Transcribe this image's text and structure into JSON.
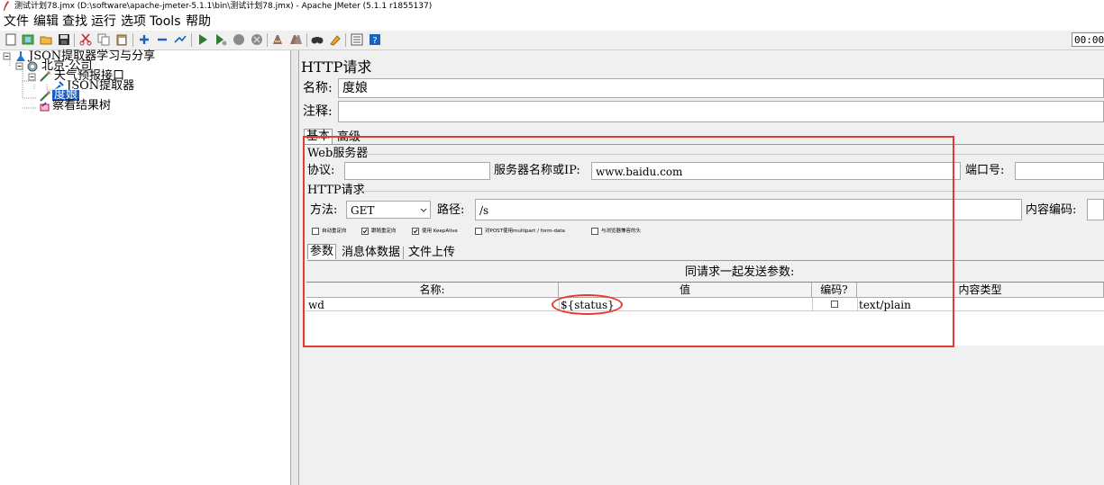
{
  "window": {
    "title": "测试计划78.jmx (D:\\software\\apache-jmeter-5.1.1\\bin\\测试计划78.jmx) - Apache JMeter (5.1.1 r1855137)"
  },
  "menu": {
    "items": [
      "文件",
      "编辑",
      "查找",
      "运行",
      "选项",
      "Tools",
      "帮助"
    ]
  },
  "toolbar": {
    "timer": "00:00",
    "icons": [
      "new-icon",
      "templates-icon",
      "open-icon",
      "save-icon",
      "cut-icon",
      "copy-icon",
      "paste-icon",
      "expand-icon",
      "collapse-icon",
      "toggle-icon",
      "start-icon",
      "start-no-pause-icon",
      "stop-icon",
      "shutdown-icon",
      "clear-icon",
      "clear-all-icon",
      "search-icon",
      "reset-search-icon",
      "function-helper-icon",
      "help-icon"
    ]
  },
  "tree": {
    "nodes": [
      {
        "label": "JSON提取器学习与分享",
        "icon": "test-plan-icon"
      },
      {
        "label": "北京-公司",
        "icon": "thread-group-icon"
      },
      {
        "label": "天气预报接口",
        "icon": "sampler-icon"
      },
      {
        "label": "JSON提取器",
        "icon": "extractor-icon"
      },
      {
        "label": "度娘",
        "icon": "sampler-icon",
        "selected": true
      },
      {
        "label": "察看结果树",
        "icon": "listener-icon"
      }
    ]
  },
  "panel": {
    "title": "HTTP请求",
    "name_label": "名称:",
    "name_value": "度娘",
    "comment_label": "注释:",
    "comment_value": "",
    "tabs": [
      "基本",
      "高级"
    ],
    "web_server": {
      "group_label": "Web服务器",
      "protocol_label": "协议:",
      "protocol_value": "",
      "server_label": "服务器名称或IP:",
      "server_value": "www.baidu.com",
      "port_label": "端口号:",
      "port_value": ""
    },
    "http_request": {
      "group_label": "HTTP请求",
      "method_label": "方法:",
      "method_value": "GET",
      "path_label": "路径:",
      "path_value": "/s",
      "encoding_label": "内容编码:",
      "encoding_value": ""
    },
    "options": [
      {
        "label": "自动重定向",
        "checked": false
      },
      {
        "label": "跟随重定向",
        "checked": true
      },
      {
        "label": "使用 KeepAlive",
        "checked": true
      },
      {
        "label": "对POST使用multipart / form-data",
        "checked": false
      },
      {
        "label": "与浏览器兼容的头",
        "checked": false
      }
    ],
    "sub_tabs": [
      "参数",
      "消息体数据",
      "文件上传"
    ],
    "params_caption": "同请求一起发送参数:",
    "table": {
      "columns": [
        "名称:",
        "值",
        "编码?",
        "内容类型"
      ],
      "rows": [
        {
          "name": "wd",
          "value": "${status}",
          "encode": false,
          "content_type": "text/plain"
        }
      ]
    }
  }
}
